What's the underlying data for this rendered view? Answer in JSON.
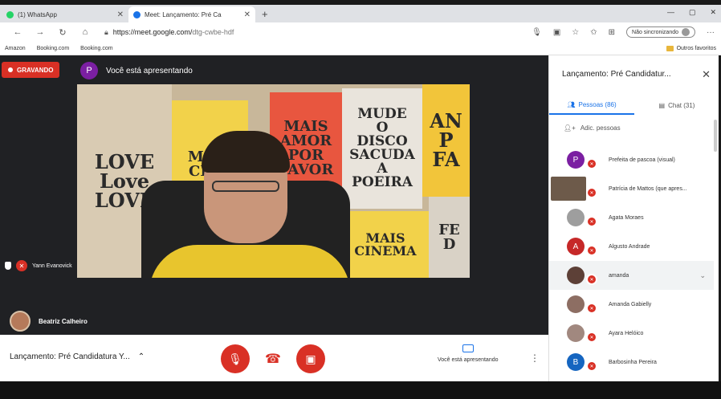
{
  "browser": {
    "tabs": [
      {
        "title": "(1) WhatsApp",
        "color": "#25d366"
      },
      {
        "title": "Meet: Lançamento: Pré Ca",
        "color": "#1a73e8"
      }
    ],
    "url_host": "https://meet.google.com/",
    "url_path": "dtg-cwbe-hdf",
    "sync_label": "Não sincronizando",
    "bookmarks": [
      "Amazon",
      "Booking.com",
      "Booking.com"
    ],
    "other_favorites": "Outros favoritos"
  },
  "meet": {
    "recording_label": "GRAVANDO",
    "presenter_initial": "P",
    "presenting_text": "Você está apresentando",
    "main_tile_name": "Yann Evanovick",
    "bottom_tile_name": "Beatriz Calheiro",
    "meeting_title": "Lançamento: Pré Candidatura Y...",
    "present_label": "Você está apresentando",
    "posters": {
      "p1": "LOVE\nLove\nLOVE",
      "p2": "MAIS\nCINE",
      "p3": "MAIS\nAMOR\nPOR\nFAVOR",
      "p4": "MUDE\nO\nDISCO\nSACUDA\nA\nPOEIRA",
      "p5": "AN\nP\nFA",
      "p6": "MAIS\nCINEMA",
      "p7": "FE\nD"
    }
  },
  "panel": {
    "title": "Lançamento: Pré Candidatur...",
    "tab_people": "Pessoas (86)",
    "tab_chat": "Chat (31)",
    "add_people": "Adic. pessoas",
    "people": [
      {
        "name": "Prefeita de pascoa (visual)",
        "initial": "P",
        "color": "#7b1fa2"
      },
      {
        "name": "Patrícia de Mattos (que apres...",
        "initial": "",
        "color": "#6d5a4a"
      },
      {
        "name": "Agata Moraes",
        "initial": "",
        "color": "#9e9e9e"
      },
      {
        "name": "Algusto Andrade",
        "initial": "A",
        "color": "#c62828"
      },
      {
        "name": "amanda",
        "initial": "",
        "color": "#5d4037"
      },
      {
        "name": "Amanda Gabielly",
        "initial": "",
        "color": "#8d6e63"
      },
      {
        "name": "Ayara Helóico",
        "initial": "",
        "color": "#a1887f"
      },
      {
        "name": "Barbosinha Pereira",
        "initial": "B",
        "color": "#1565c0"
      }
    ]
  },
  "colors": {
    "accent": "#1a73e8",
    "danger": "#d93025"
  }
}
